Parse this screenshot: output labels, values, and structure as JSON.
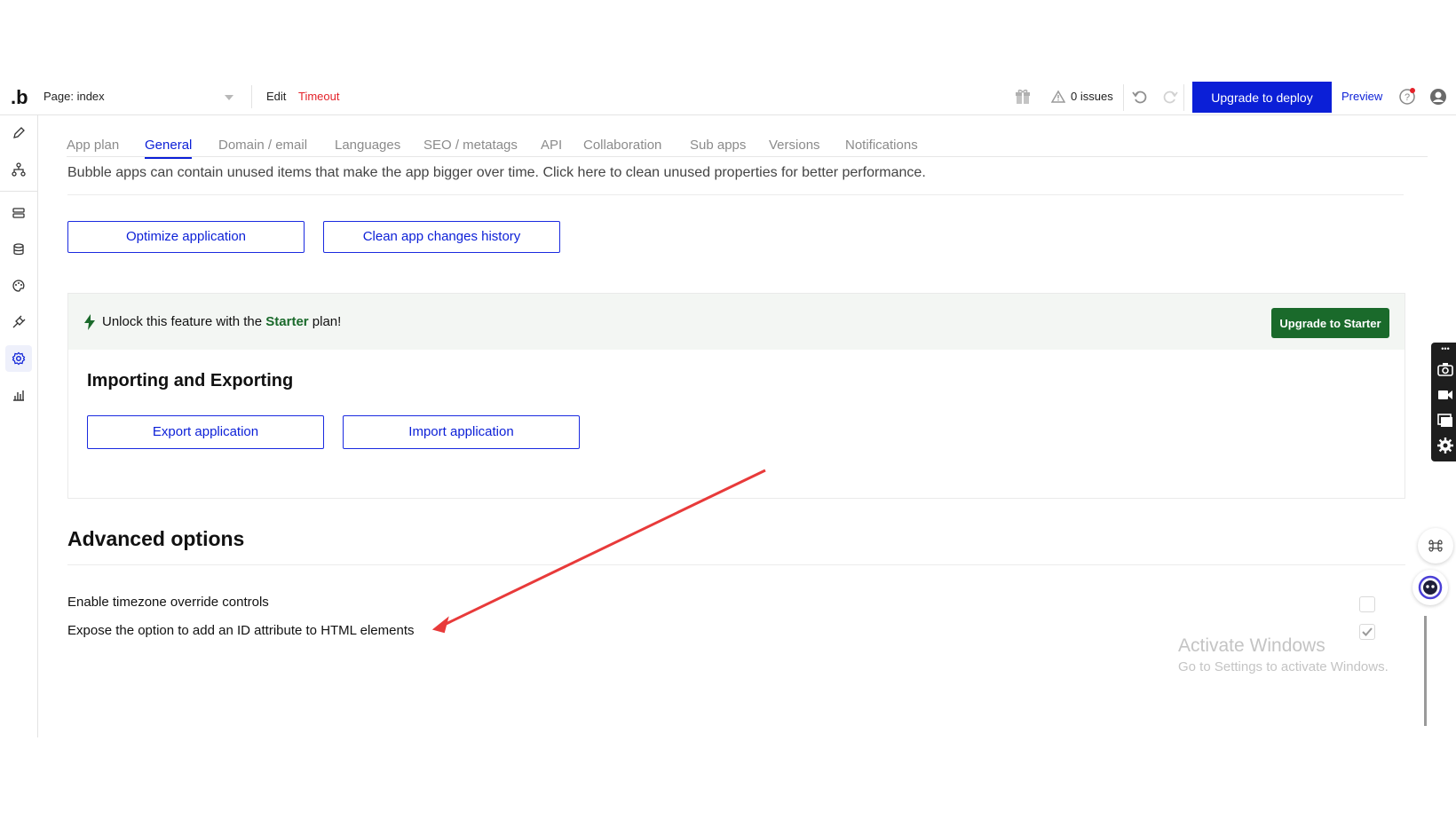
{
  "topbar": {
    "logo": ".b",
    "page_select": "Page: index",
    "edit": "Edit",
    "timeout": "Timeout",
    "issues": "0 issues",
    "upgrade_deploy": "Upgrade to deploy",
    "preview": "Preview"
  },
  "tabs": [
    "App plan",
    "General",
    "Domain / email",
    "Languages",
    "SEO / metatags",
    "API",
    "Collaboration",
    "Sub apps",
    "Versions",
    "Notifications"
  ],
  "active_tab": "General",
  "notice": "Bubble apps can contain unused items that make the app bigger over time. Click here to clean unused properties for better performance.",
  "buttons": {
    "optimize": "Optimize application",
    "clean_history": "Clean app changes history"
  },
  "upsell": {
    "prefix": "Unlock this feature with the ",
    "plan": "Starter",
    "suffix": " plan!",
    "button": "Upgrade to Starter",
    "section_title": "Importing and Exporting",
    "export": "Export application",
    "import": "Import application"
  },
  "advanced": {
    "title": "Advanced options",
    "options": [
      {
        "label": "Enable timezone override controls",
        "checked": false
      },
      {
        "label": "Expose the option to add an ID attribute to HTML elements",
        "checked": true
      }
    ]
  },
  "watermark": {
    "title": "Activate Windows",
    "subtitle": "Go to Settings to activate Windows."
  },
  "colors": {
    "primary": "#0b1fd7",
    "starter_green": "#1a6a2b",
    "timeout_red": "#e4222a",
    "annotation_arrow": "#e83a3a"
  },
  "icons": {
    "sidebar": [
      "pencil-icon",
      "workflow-icon",
      "data-icon",
      "database-icon",
      "palette-icon",
      "plugin-icon",
      "settings-icon",
      "chart-icon"
    ],
    "topbar": [
      "gift-icon",
      "warning-icon",
      "undo-icon",
      "redo-icon",
      "search-icon",
      "help-icon",
      "account-icon"
    ]
  }
}
